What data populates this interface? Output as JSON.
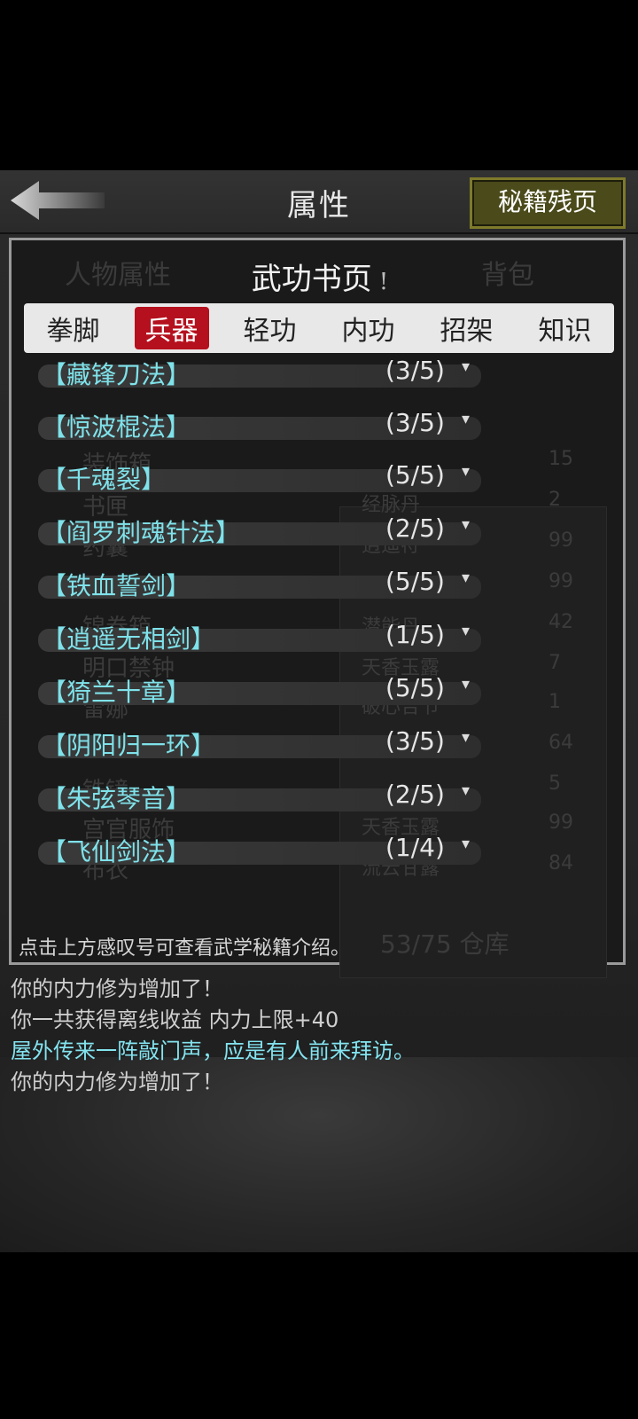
{
  "header": {
    "title": "属性",
    "secret_button": "秘籍残页"
  },
  "background": {
    "tabs": [
      "人物属性",
      "背包"
    ],
    "items": [
      "装饰箱",
      "书匣",
      "药囊",
      "锦卷箱",
      "明口禁钟",
      "雷娜",
      "铁镜",
      "宫官服饰",
      "布衣"
    ],
    "capacity": "53/75 仓库",
    "side_items": [
      "经脉丹",
      "逍遥符",
      "潜能丹",
      "天香玉露",
      "破心合节",
      "天香玉露",
      "流云甘露"
    ],
    "side_counts": [
      "15",
      "2",
      "99",
      "99",
      "42",
      "7",
      "1",
      "64",
      "5",
      "99",
      "84"
    ]
  },
  "overlay": {
    "title": "武功书页",
    "info_mark": "!",
    "tabs": [
      {
        "label": "拳脚",
        "active": false
      },
      {
        "label": "兵器",
        "active": true
      },
      {
        "label": "轻功",
        "active": false
      },
      {
        "label": "内功",
        "active": false
      },
      {
        "label": "招架",
        "active": false
      },
      {
        "label": "知识",
        "active": false
      }
    ],
    "skills": [
      {
        "name": "【藏锋刀法】",
        "count": "(3/5)"
      },
      {
        "name": "【惊波棍法】",
        "count": "(3/5)"
      },
      {
        "name": "【千魂裂】",
        "count": "(5/5)"
      },
      {
        "name": "【阎罗刺魂针法】",
        "count": "(2/5)"
      },
      {
        "name": "【铁血誓剑】",
        "count": "(5/5)"
      },
      {
        "name": "【逍遥无相剑】",
        "count": "(1/5)"
      },
      {
        "name": "【猗兰十章】",
        "count": "(5/5)"
      },
      {
        "name": "【阴阳归一环】",
        "count": "(3/5)"
      },
      {
        "name": "【朱弦琴音】",
        "count": "(2/5)"
      },
      {
        "name": "【飞仙剑法】",
        "count": "(1/4)"
      }
    ],
    "hint": "点击上方感叹号可查看武学秘籍介绍。"
  },
  "log": [
    {
      "text": "你的内力修为增加了！",
      "color": "#cfcfcf"
    },
    {
      "text": "你一共获得离线收益 内力上限+40",
      "color": "#cfcfcf"
    },
    {
      "text": "屋外传来一阵敲门声，应是有人前来拜访。",
      "color": "#83e4f0"
    },
    {
      "text": "你的内力修为增加了！",
      "color": "#cfcfcf"
    }
  ],
  "colors": {
    "accent": "#b5101e",
    "skill_text": "#7fe2ea",
    "button_bg": "#4a4a1a"
  }
}
